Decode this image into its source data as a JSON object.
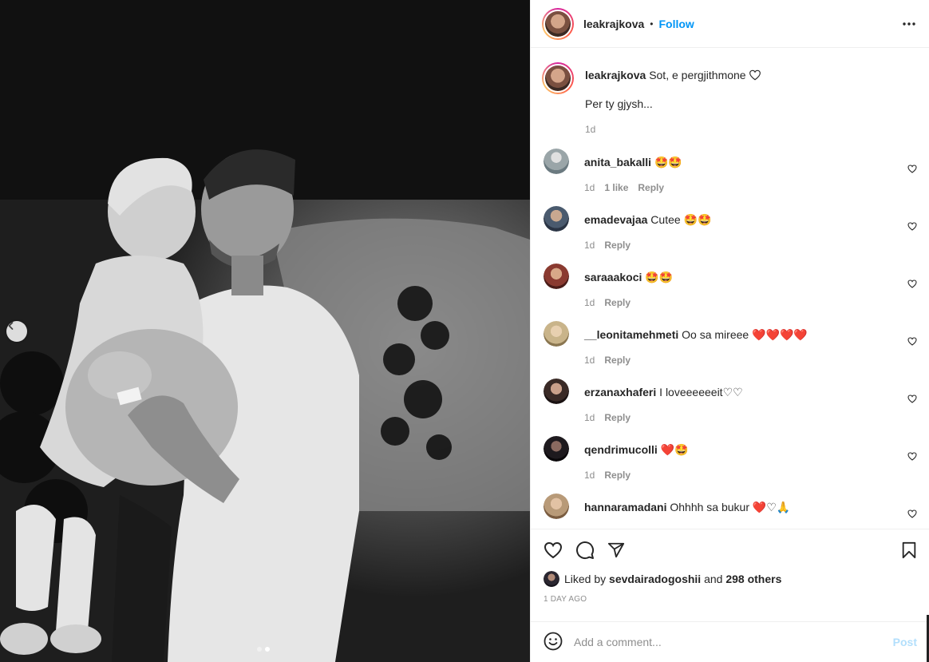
{
  "post": {
    "author": "leakrajkova",
    "separator": "•",
    "follow_label": "Follow",
    "more_icon": "more-horizontal-icon"
  },
  "caption": {
    "username": "leakrajkova",
    "text_line1": "Sot, e pergjithmone",
    "text_line2": "Per ty gjysh...",
    "time": "1d"
  },
  "comments": [
    {
      "username": "anita_bakalli",
      "text": "",
      "emoji": "🤩🤩",
      "time": "1d",
      "likes": "1 like",
      "reply": "Reply",
      "avatar_color": "#9aa5a8"
    },
    {
      "username": "emadevajaa",
      "text": "Cutee",
      "emoji": "🤩🤩",
      "time": "1d",
      "likes": "",
      "reply": "Reply",
      "avatar_color": "#4a5a6e"
    },
    {
      "username": "saraaakoci",
      "text": "",
      "emoji": "🤩🤩",
      "time": "1d",
      "likes": "",
      "reply": "Reply",
      "avatar_color": "#8a3a30"
    },
    {
      "username": "__leonitamehmeti",
      "text": "Oo sa mireee",
      "emoji": "❤️❤️❤️❤️",
      "time": "1d",
      "likes": "",
      "reply": "Reply",
      "avatar_color": "#c9b48a"
    },
    {
      "username": "erzanaxhaferi",
      "text": "I loveeeeeeit",
      "emoji": "♡♡",
      "time": "1d",
      "likes": "",
      "reply": "Reply",
      "avatar_color": "#3a2a26"
    },
    {
      "username": "qendrimucolli",
      "text": "",
      "emoji": "❤️🤩",
      "time": "1d",
      "likes": "",
      "reply": "Reply",
      "avatar_color": "#1e1a1e"
    },
    {
      "username": "hannaramadani",
      "text": "Ohhhh sa bukur",
      "emoji": "❤️♡🙏",
      "time": "",
      "likes": "",
      "reply": "",
      "avatar_color": "#b89a78"
    }
  ],
  "actions": {
    "like_icon": "heart-outline-icon",
    "comment_icon": "comment-icon",
    "share_icon": "send-icon",
    "save_icon": "bookmark-icon"
  },
  "likes": {
    "prefix": "Liked by",
    "user": "sevdairadogoshii",
    "middle": "and",
    "others": "298 others"
  },
  "date": "1 DAY AGO",
  "add_comment": {
    "placeholder": "Add a comment...",
    "post_label": "Post",
    "emoji_icon": "smiley-icon"
  },
  "carousel": {
    "current": 2,
    "total": 2
  },
  "colors": {
    "accent": "#0095f6",
    "post_disabled": "#b2dffc",
    "muted": "#8e8e8e",
    "like_red": "#ed4956"
  }
}
